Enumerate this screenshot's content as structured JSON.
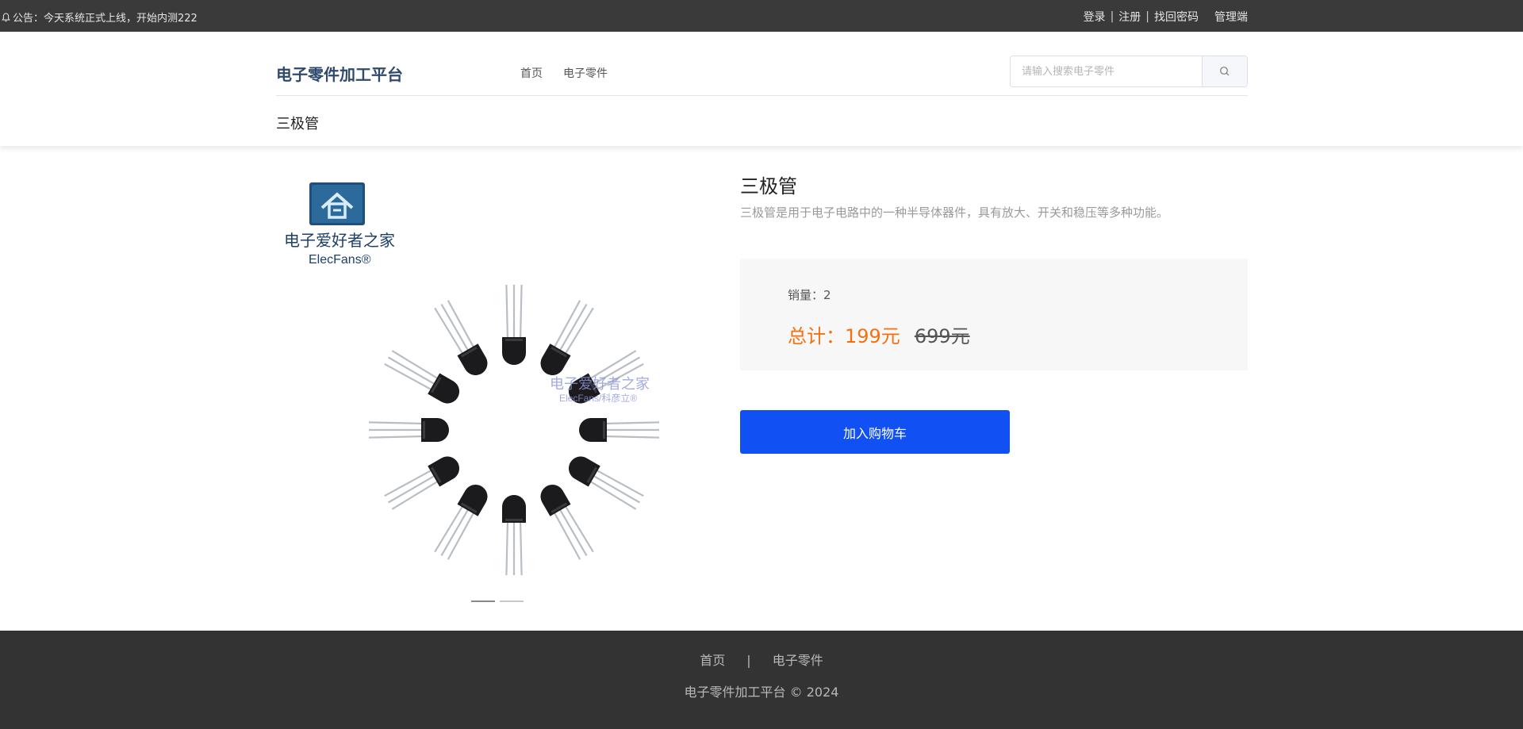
{
  "topbar": {
    "notice_icon": "bell-icon",
    "notice": "公告：今天系统正式上线，开始内测222",
    "login": "登录",
    "register": "注册",
    "find_password": "找回密码",
    "separator": "|",
    "admin": "管理端"
  },
  "header": {
    "brand": "电子零件加工平台",
    "nav": [
      "首页",
      "电子零件"
    ],
    "search_placeholder": "请输入搜索电子零件",
    "search_icon": "search-icon",
    "breadcrumb": "三极管"
  },
  "product": {
    "image_logo_text": "电子爱好者之家",
    "image_logo_sub": "ElecFans®",
    "image_watermark": "电子爱好者之家",
    "image_watermark_sub": "ElecFans/科彦立®",
    "title": "三极管",
    "description": "三极管是用于电子电路中的一种半导体器件，具有放大、开关和稳压等多种功能。",
    "sales_label": "销量：",
    "sales": "2",
    "price_label": "总计：",
    "price": "199元",
    "original_price": "699元",
    "carousel_slides": 2,
    "carousel_active": 1,
    "add_to_cart": "加入购物车"
  },
  "footer": {
    "nav": [
      "首页",
      "电子零件"
    ],
    "separator": "|",
    "copyright": "电子零件加工平台 © 2024"
  },
  "colors": {
    "topbar_bg": "#3a3a3a",
    "brand": "#2f4a6d",
    "price": "#f5700f",
    "cart_button": "#1150f3",
    "footer_bg": "#333333"
  }
}
